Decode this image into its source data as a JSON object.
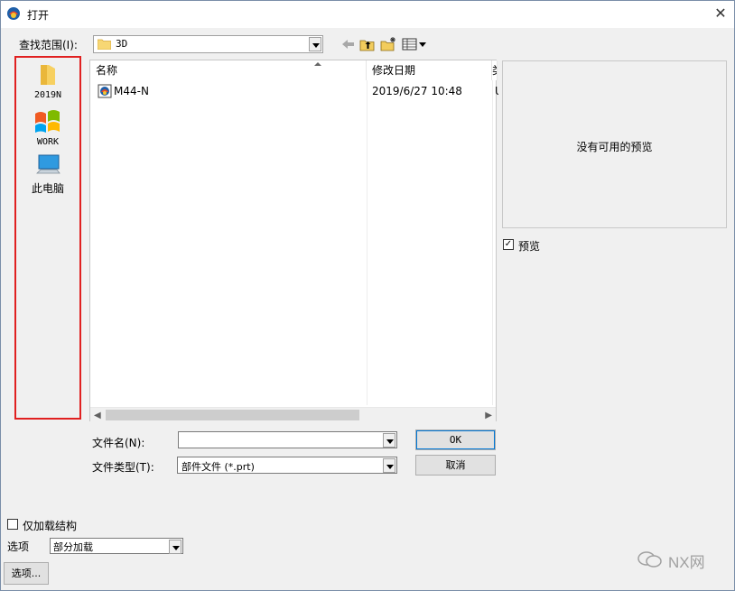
{
  "window": {
    "title": "打开"
  },
  "look_in": {
    "label": "查找范围(I):",
    "value": "3D"
  },
  "places": [
    {
      "label": "2019N",
      "icon": "folder-icon"
    },
    {
      "label": "WORK",
      "icon": "work-logo-icon"
    },
    {
      "label": "此电脑",
      "icon": "computer-icon"
    }
  ],
  "file_list": {
    "columns": [
      "名称",
      "修改日期"
    ],
    "rows": [
      {
        "name": "M44-N",
        "date": "2019/6/27 10:48",
        "extra": "U"
      }
    ],
    "col3_header": "类"
  },
  "preview": {
    "message": "没有可用的预览",
    "checkbox_label": "预览",
    "checked": true
  },
  "file_name": {
    "label": "文件名(N):",
    "value": ""
  },
  "file_type": {
    "label": "文件类型(T):",
    "value": "部件文件 (*.prt)"
  },
  "buttons": {
    "ok": "OK",
    "cancel": "取消",
    "options": "选项..."
  },
  "load_structure": {
    "label": "仅加载结构",
    "checked": false
  },
  "options": {
    "label": "选项",
    "value": "部分加载"
  },
  "watermark": {
    "text": "NX网"
  },
  "colors": {
    "highlight_border": "#e02020",
    "accent": "#0078d7"
  }
}
